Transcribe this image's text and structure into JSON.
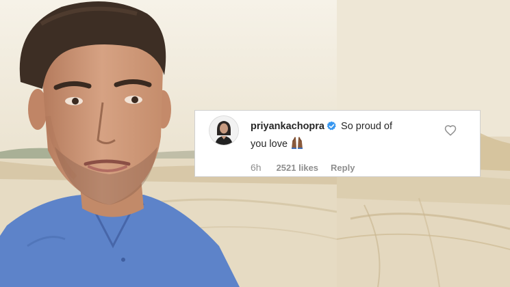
{
  "comment": {
    "username": "priyankachopra",
    "verified": true,
    "text_line1": "So proud of",
    "text_line2": "you love",
    "emoji": "raising-hands-emoji",
    "time": "6h",
    "likes": "2521 likes",
    "reply_label": "Reply",
    "liked": false
  },
  "colors": {
    "verified_badge": "#3897f0",
    "username": "#262626",
    "meta_text": "#8e8e8e",
    "shirt": "#5d83c9"
  },
  "icons": [
    "verified-badge-icon",
    "heart-icon",
    "raising-hands-emoji"
  ]
}
